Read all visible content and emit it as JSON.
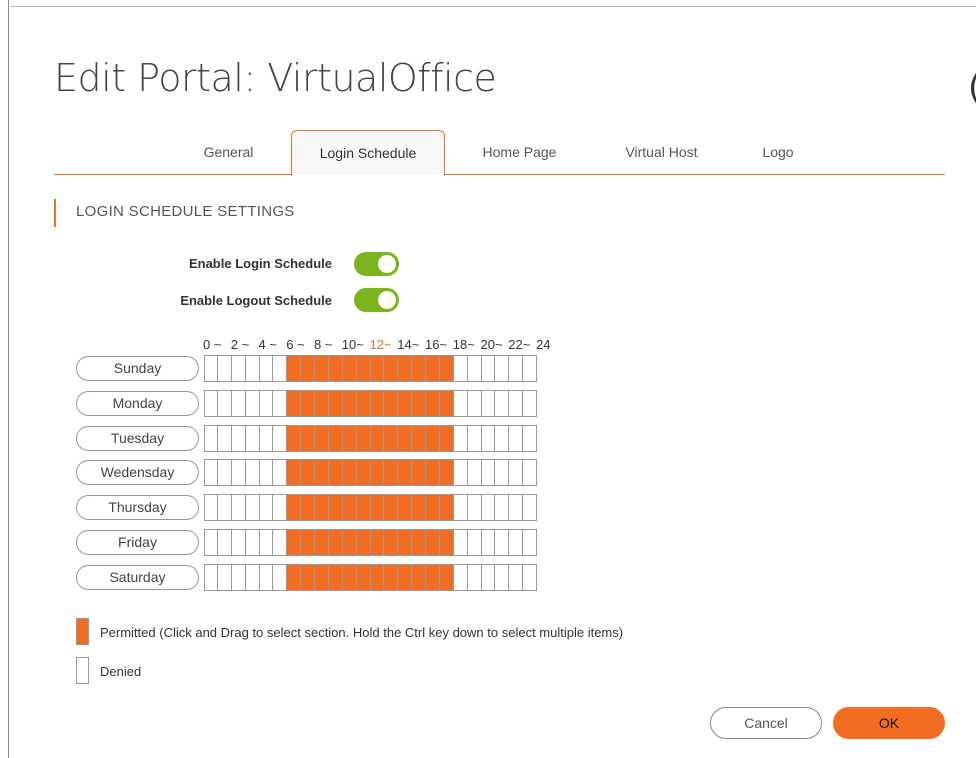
{
  "dialog": {
    "title": "Edit Portal: VirtualOffice",
    "clipped_glyph": "("
  },
  "tabs": [
    {
      "label": "General",
      "active": false
    },
    {
      "label": "Login Schedule",
      "active": true
    },
    {
      "label": "Home Page",
      "active": false
    },
    {
      "label": "Virtual Host",
      "active": false
    },
    {
      "label": "Logo",
      "active": false
    }
  ],
  "section": {
    "title": "LOGIN SCHEDULE SETTINGS"
  },
  "toggles": {
    "login": {
      "label": "Enable Login Schedule",
      "on": true
    },
    "logout": {
      "label": "Enable Logout Schedule",
      "on": true
    }
  },
  "hours_header": [
    "0 ~",
    "2 ~",
    "4 ~",
    "6 ~",
    "8 ~",
    "10~",
    "12~",
    "14~",
    "16~",
    "18~",
    "20~",
    "22~",
    "24"
  ],
  "hours_highlight_index": 6,
  "schedule": {
    "slots_per_day": 24,
    "permitted_start": 6,
    "permitted_end": 18,
    "days": [
      "Sunday",
      "Monday",
      "Tuesday",
      "Wedensday",
      "Thursday",
      "Friday",
      "Saturday"
    ]
  },
  "legend": {
    "permitted": "Permitted (Click and Drag to select section. Hold the Ctrl key down to select multiple items)",
    "denied": "Denied"
  },
  "footer": {
    "cancel_label": "Cancel",
    "ok_label": "OK"
  },
  "colors": {
    "accent": "#f26d21",
    "toggle_on": "#7ab51d"
  }
}
